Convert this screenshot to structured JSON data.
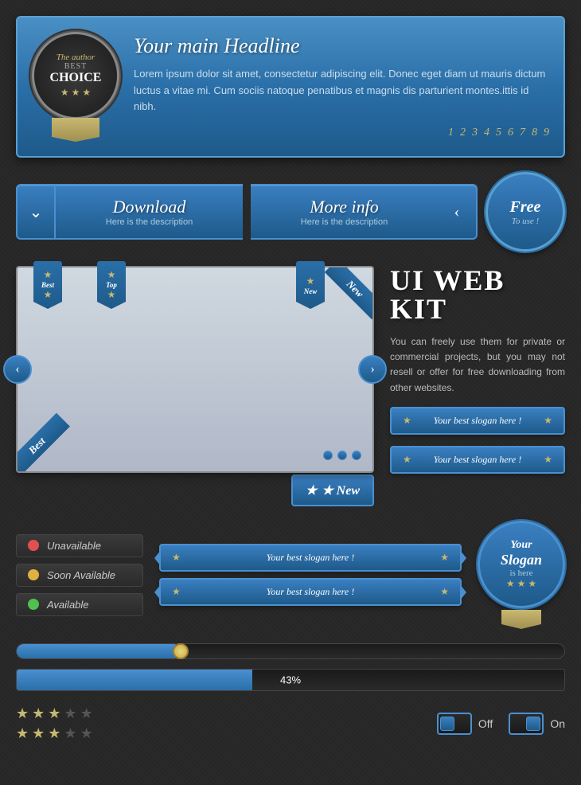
{
  "hero": {
    "badge": {
      "script": "The author",
      "text": "BEST",
      "main": "CHOICE",
      "stars": "★ ★ ★"
    },
    "title": "Your main Headline",
    "description": "Lorem ipsum dolor sit amet, consectetur adipiscing elit. Donec eget diam ut mauris dictum luctus a vitae mi. Cum sociis natoque penatibus et magnis dis parturient montes.ittis id nibh.",
    "pagination": [
      "1",
      "2",
      "3",
      "4",
      "5",
      "6",
      "7",
      "8",
      "9"
    ]
  },
  "buttons": {
    "download": {
      "label": "Download",
      "description": "Here is the description"
    },
    "more_info": {
      "label": "More info",
      "description": "Here is the description"
    },
    "free": {
      "label": "Free",
      "sub": "To use !"
    }
  },
  "ribbons": [
    {
      "star": "★",
      "label": "Best"
    },
    {
      "star": "★",
      "label": "Top"
    },
    {
      "star": "★",
      "label": "New"
    }
  ],
  "new_tag": "★ New",
  "best_label": "Best",
  "slider_dots": 3,
  "ui_kit": {
    "title": "UI WEB KIT",
    "description": "You can freely use them for private or commercial projects, but you may not resell or offer for free downloading from other websites."
  },
  "slogans": [
    {
      "star": "★",
      "text": "Your best slogan here !",
      "star2": "★"
    },
    {
      "star": "★",
      "text": "Your best slogan here !",
      "star2": "★"
    }
  ],
  "slogans_status": [
    {
      "star": "★",
      "text": "Your best slogan here !",
      "star2": "★"
    },
    {
      "star": "★",
      "text": "Your best slogan here !",
      "star2": "★"
    }
  ],
  "status": [
    {
      "color": "#e05050",
      "label": "Unavailable"
    },
    {
      "color": "#e0b040",
      "label": "Soon Available"
    },
    {
      "color": "#50c050",
      "label": "Available"
    }
  ],
  "badge_round": {
    "line1": "Your",
    "line2": "Slogan",
    "line3": "is here",
    "stars": "★ ★ ★"
  },
  "progress": {
    "slider_pct": 30,
    "bar_pct": 43,
    "bar_label": "43%"
  },
  "stars_rows": [
    [
      true,
      true,
      true,
      false,
      false
    ],
    [
      true,
      true,
      true,
      false,
      false
    ]
  ],
  "toggles": [
    {
      "label": "Off",
      "on": false
    },
    {
      "label": "On",
      "on": true
    }
  ]
}
